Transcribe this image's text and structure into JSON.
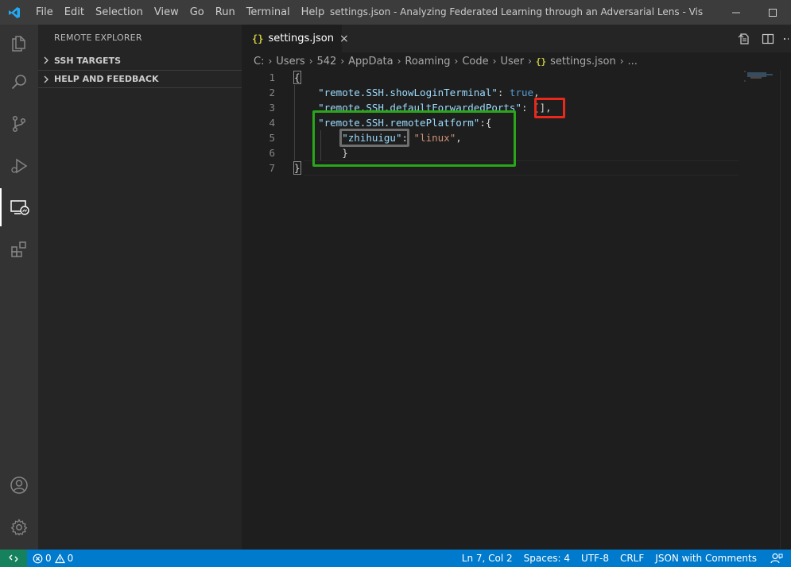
{
  "titlebar": {
    "menu": [
      "File",
      "Edit",
      "Selection",
      "View",
      "Go",
      "Run",
      "Terminal",
      "Help"
    ],
    "window_title": "settings.json - Analyzing Federated Learning through an Adversarial Lens - Visual Studi..."
  },
  "sidebar": {
    "title": "REMOTE EXPLORER",
    "sections": [
      "SSH TARGETS",
      "HELP AND FEEDBACK"
    ]
  },
  "tab": {
    "icon": "{}",
    "label": "settings.json",
    "close": "×"
  },
  "breadcrumb": {
    "parts": [
      "C:",
      "Users",
      "542",
      "AppData",
      "Roaming",
      "Code",
      "User"
    ],
    "file_icon": "{}",
    "file": "settings.json",
    "more": "..."
  },
  "editor": {
    "line_numbers": [
      "1",
      "2",
      "3",
      "4",
      "5",
      "6",
      "7"
    ],
    "line1": {
      "open": "{"
    },
    "line2": {
      "key": "\"remote.SSH.showLoginTerminal\"",
      "colon": ": ",
      "value": "true",
      "comma": ","
    },
    "line3": {
      "key": "\"remote.SSH.defaultForwardedPorts\"",
      "colon": ": ",
      "value": "[],",
      "comma": ""
    },
    "line4": {
      "key": "\"remote.SSH.remotePlatform\"",
      "colon": ":",
      "brace": "{"
    },
    "line5": {
      "key": "\"zhihuigu\"",
      "colon": ": ",
      "value": "\"linux\"",
      "comma": ","
    },
    "line6": {
      "close": "}"
    },
    "line7": {
      "close": "}"
    }
  },
  "statusbar": {
    "errors": "0",
    "warnings": "0",
    "position": "Ln 7, Col 2",
    "spaces": "Spaces: 4",
    "encoding": "UTF-8",
    "eol": "CRLF",
    "language": "JSON with Comments"
  },
  "colors": {
    "statusbar": "#007acc",
    "remote_indicator": "#16825d",
    "annotation_red": "#e8291c",
    "annotation_green": "#2aa61b"
  }
}
